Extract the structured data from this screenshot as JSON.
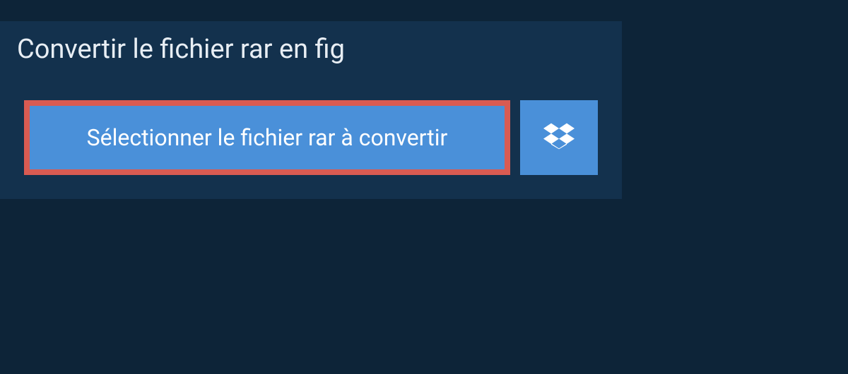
{
  "header": {
    "title": "Convertir le fichier rar en fig"
  },
  "actions": {
    "select_file_label": "Sélectionner le fichier rar à convertir",
    "dropbox_icon": "dropbox"
  },
  "colors": {
    "bg": "#0d2438",
    "panel": "#13314d",
    "button": "#4a90d9",
    "highlight_border": "#d95b52",
    "text_light": "#ffffff"
  }
}
